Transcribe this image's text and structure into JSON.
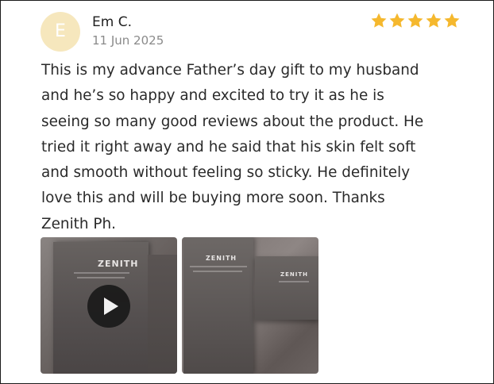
{
  "review": {
    "avatar_initial": "E",
    "reviewer_name": "Em C.",
    "date": "11 Jun 2025",
    "rating": 5,
    "rating_max": 5,
    "star_color": "#f5b82e",
    "text_lines": [
      "This is my advance Father’s day gift to my husband",
      "and he’s so happy and excited to try it as he is",
      "seeing so many good reviews about the product. He",
      "tried it right away and he said that his skin felt soft",
      "and smooth without feeling so sticky. He definitely",
      "love this and will be buying more soon. Thanks",
      "Zenith Ph."
    ],
    "media": [
      {
        "type": "video",
        "product_label": "ZENITH"
      },
      {
        "type": "image",
        "product_label": "ZENITH",
        "product_label_2": "ZENITH"
      }
    ]
  },
  "icons": {
    "star": "star-icon",
    "play": "play-icon"
  }
}
